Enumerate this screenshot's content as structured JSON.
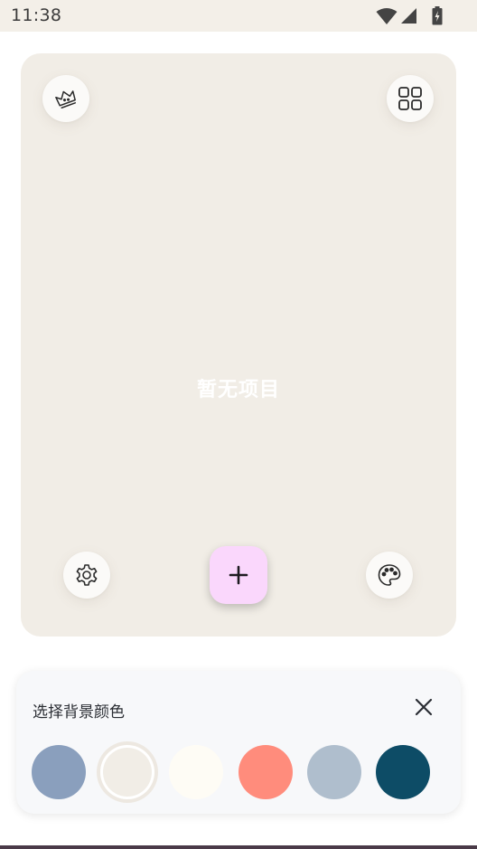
{
  "status_bar": {
    "time": "11:38",
    "icons": [
      "wifi-icon",
      "signal-icon",
      "battery-charging-icon"
    ]
  },
  "card": {
    "empty_text": "暂无项目",
    "top_left_icon": "crown-icon",
    "top_right_icon": "grid-icon",
    "bottom_left_icon": "gear-icon",
    "bottom_right_icon": "palette-icon",
    "fab_icon": "plus-icon",
    "fab_color": "#fad7fc"
  },
  "color_sheet": {
    "title": "选择背景颜色",
    "close_icon": "close-icon",
    "swatches": [
      {
        "color": "#8a9fbd",
        "selected": false
      },
      {
        "color": "#f1ede6",
        "selected": true
      },
      {
        "color": "#fefcf5",
        "selected": false
      },
      {
        "color": "#ff8c7c",
        "selected": false
      },
      {
        "color": "#afbecd",
        "selected": false
      },
      {
        "color": "#0d4c66",
        "selected": false
      }
    ]
  }
}
